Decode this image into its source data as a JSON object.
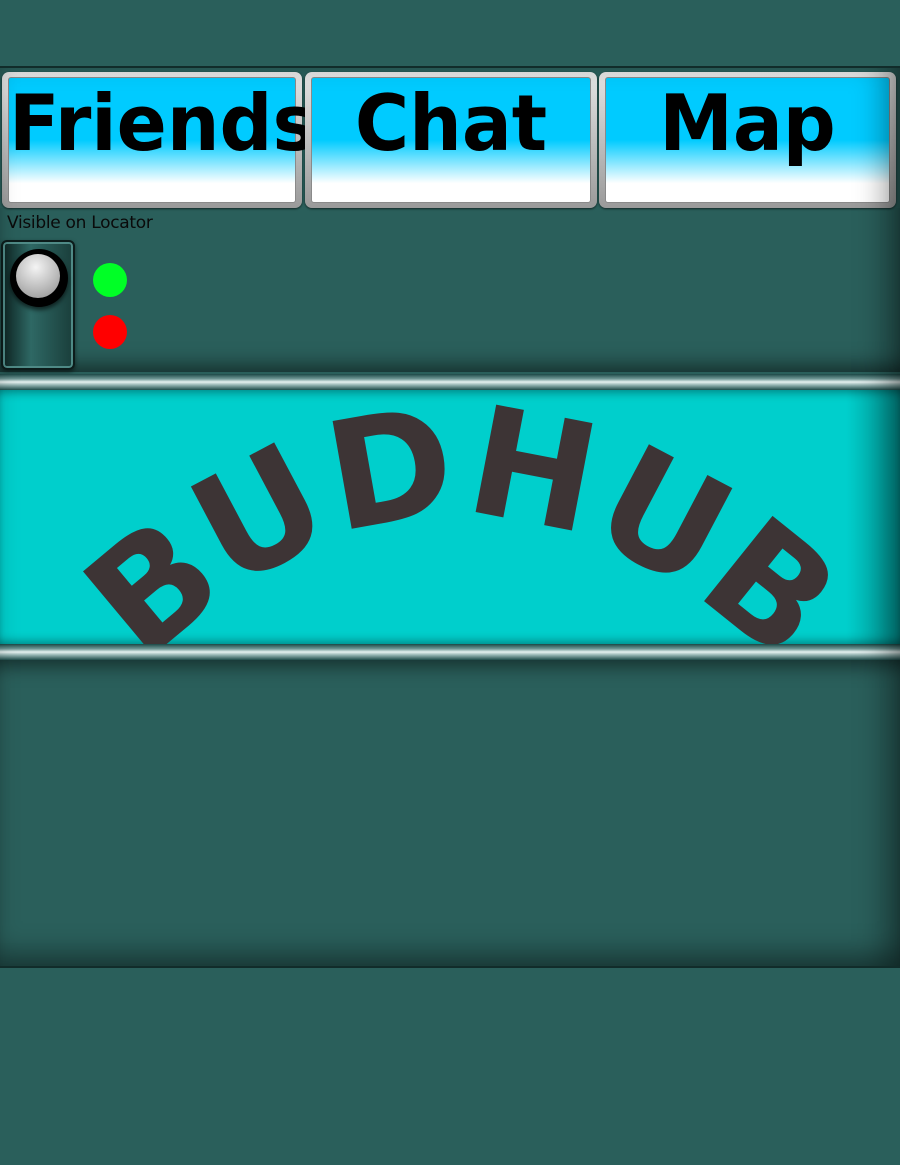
{
  "tabs": [
    {
      "label": "Friends"
    },
    {
      "label": "Chat"
    },
    {
      "label": "Map"
    }
  ],
  "locator": {
    "title": "Visible on Locator",
    "on_color": "#00ff26",
    "off_color": "#ff0000"
  },
  "banner": {
    "logo_text": "BUDHUB",
    "logo_color": "#3d3435",
    "background": "#00cfcc"
  },
  "colors": {
    "page_background": "#2a5f5b",
    "tab_gradient_top": "#00cbff",
    "tab_gradient_bottom": "#ffffff"
  }
}
